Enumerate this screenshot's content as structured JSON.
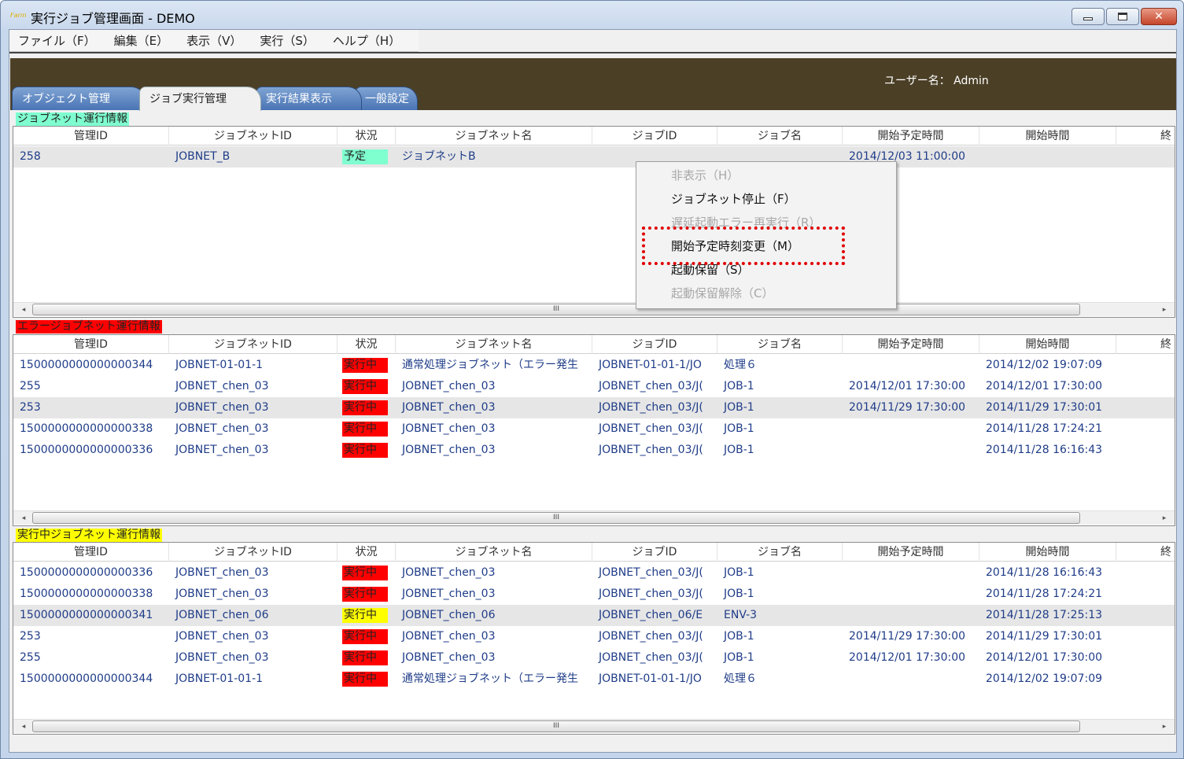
{
  "window": {
    "icon_text": "Farm",
    "title": "実行ジョブ管理画面 - DEMO",
    "minimize": "▭",
    "maximize": "□",
    "close": "✕"
  },
  "menu": [
    "ファイル（F）",
    "編集（E）",
    "表示（V）",
    "実行（S）",
    "ヘルプ（H）"
  ],
  "header": {
    "user": "ユーザー名： Admin"
  },
  "tabs": [
    {
      "label": "オブジェクト管理",
      "active": false
    },
    {
      "label": "ジョブ実行管理",
      "active": true
    },
    {
      "label": "実行結果表示",
      "active": false
    },
    {
      "label": "一般設定",
      "active": false
    }
  ],
  "columns": [
    "管理ID",
    "ジョブネットID",
    "状況",
    "ジョブネット名",
    "ジョブID",
    "ジョブ名",
    "開始予定時間",
    "開始時間",
    "終"
  ],
  "scroll": {
    "left": "◂",
    "right": "▸",
    "grip": "III"
  },
  "sections": {
    "jobnet": {
      "label": "ジョブネット運行情報",
      "rows": [
        {
          "id": "258",
          "jobnet_id": "JOBNET_B",
          "status": "予定",
          "status_color": "#7fffd0",
          "jobnet_name": "ジョブネットB",
          "job_id": "",
          "job_name": "",
          "planned": "2014/12/03 11:00:00",
          "start": "",
          "selected": true
        }
      ]
    },
    "error": {
      "label": "エラージョブネット運行情報",
      "rows": [
        {
          "id": "1500000000000000344",
          "jobnet_id": "JOBNET-01-01-1",
          "status": "実行中",
          "status_color": "#ff0000",
          "jobnet_name": "通常処理ジョブネット（エラー発生",
          "job_id": "JOBNET-01-01-1/JO",
          "job_name": "処理６",
          "planned": "",
          "start": "2014/12/02 19:07:09",
          "selected": false
        },
        {
          "id": "255",
          "jobnet_id": "JOBNET_chen_03",
          "status": "実行中",
          "status_color": "#ff0000",
          "jobnet_name": "JOBNET_chen_03",
          "job_id": "JOBNET_chen_03/J(",
          "job_name": "JOB-1",
          "planned": "2014/12/01 17:30:00",
          "start": "2014/12/01 17:30:00",
          "selected": false
        },
        {
          "id": "253",
          "jobnet_id": "JOBNET_chen_03",
          "status": "実行中",
          "status_color": "#ff0000",
          "jobnet_name": "JOBNET_chen_03",
          "job_id": "JOBNET_chen_03/J(",
          "job_name": "JOB-1",
          "planned": "2014/11/29 17:30:00",
          "start": "2014/11/29 17:30:01",
          "selected": true
        },
        {
          "id": "1500000000000000338",
          "jobnet_id": "JOBNET_chen_03",
          "status": "実行中",
          "status_color": "#ff0000",
          "jobnet_name": "JOBNET_chen_03",
          "job_id": "JOBNET_chen_03/J(",
          "job_name": "JOB-1",
          "planned": "",
          "start": "2014/11/28 17:24:21",
          "selected": false
        },
        {
          "id": "1500000000000000336",
          "jobnet_id": "JOBNET_chen_03",
          "status": "実行中",
          "status_color": "#ff0000",
          "jobnet_name": "JOBNET_chen_03",
          "job_id": "JOBNET_chen_03/J(",
          "job_name": "JOB-1",
          "planned": "",
          "start": "2014/11/28 16:16:43",
          "selected": false
        }
      ]
    },
    "running": {
      "label": "実行中ジョブネット運行情報",
      "rows": [
        {
          "id": "1500000000000000336",
          "jobnet_id": "JOBNET_chen_03",
          "status": "実行中",
          "status_color": "#ff0000",
          "jobnet_name": "JOBNET_chen_03",
          "job_id": "JOBNET_chen_03/J(",
          "job_name": "JOB-1",
          "planned": "",
          "start": "2014/11/28 16:16:43",
          "selected": false
        },
        {
          "id": "1500000000000000338",
          "jobnet_id": "JOBNET_chen_03",
          "status": "実行中",
          "status_color": "#ff0000",
          "jobnet_name": "JOBNET_chen_03",
          "job_id": "JOBNET_chen_03/J(",
          "job_name": "JOB-1",
          "planned": "",
          "start": "2014/11/28 17:24:21",
          "selected": false
        },
        {
          "id": "1500000000000000341",
          "jobnet_id": "JOBNET_chen_06",
          "status": "実行中",
          "status_color": "#ffff00",
          "jobnet_name": "JOBNET_chen_06",
          "job_id": "JOBNET_chen_06/E",
          "job_name": "ENV-3",
          "planned": "",
          "start": "2014/11/28 17:25:13",
          "selected": true
        },
        {
          "id": "253",
          "jobnet_id": "JOBNET_chen_03",
          "status": "実行中",
          "status_color": "#ff0000",
          "jobnet_name": "JOBNET_chen_03",
          "job_id": "JOBNET_chen_03/J(",
          "job_name": "JOB-1",
          "planned": "2014/11/29 17:30:00",
          "start": "2014/11/29 17:30:01",
          "selected": false
        },
        {
          "id": "255",
          "jobnet_id": "JOBNET_chen_03",
          "status": "実行中",
          "status_color": "#ff0000",
          "jobnet_name": "JOBNET_chen_03",
          "job_id": "JOBNET_chen_03/J(",
          "job_name": "JOB-1",
          "planned": "2014/12/01 17:30:00",
          "start": "2014/12/01 17:30:00",
          "selected": false
        },
        {
          "id": "1500000000000000344",
          "jobnet_id": "JOBNET-01-01-1",
          "status": "実行中",
          "status_color": "#ff0000",
          "jobnet_name": "通常処理ジョブネット（エラー発生",
          "job_id": "JOBNET-01-01-1/JO",
          "job_name": "処理６",
          "planned": "",
          "start": "2014/12/02 19:07:09",
          "selected": false
        }
      ]
    }
  },
  "context_menu": [
    {
      "label": "非表示（H）",
      "enabled": false
    },
    {
      "label": "ジョブネット停止（F）",
      "enabled": true
    },
    {
      "label": "遅延起動エラー再実行（R）",
      "enabled": false
    },
    {
      "label": "開始予定時刻変更（M）",
      "enabled": true,
      "highlighted": true
    },
    {
      "label": "起動保留（S）",
      "enabled": true
    },
    {
      "label": "起動保留解除（C）",
      "enabled": false
    }
  ]
}
